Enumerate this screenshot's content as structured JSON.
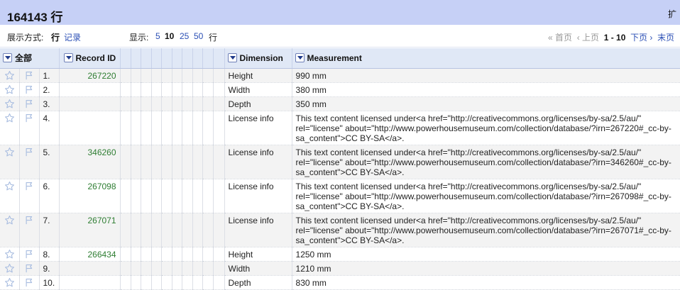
{
  "header": {
    "row_count": "164143 行",
    "right_label": "扩"
  },
  "view": {
    "label": "展示方式:",
    "rows_mode": "行",
    "records_mode": "记录",
    "show_label": "显示:",
    "page_sizes": [
      "5",
      "10",
      "25",
      "50"
    ],
    "page_size_selected": "10",
    "rows_suffix": "行"
  },
  "pager": {
    "first": "« 首页",
    "prev": "‹ 上页",
    "range": "1 - 10",
    "next": "下页 ›",
    "last": "末页"
  },
  "columns": {
    "all": "全部",
    "record_id": "Record ID",
    "dimension": "Dimension",
    "measurement": "Measurement"
  },
  "rows": [
    {
      "index": "1.",
      "record_id": "267220",
      "dimension": "Height",
      "measurement": "990 mm"
    },
    {
      "index": "2.",
      "record_id": "",
      "dimension": "Width",
      "measurement": "380 mm"
    },
    {
      "index": "3.",
      "record_id": "",
      "dimension": "Depth",
      "measurement": "350 mm"
    },
    {
      "index": "4.",
      "record_id": "",
      "dimension": "License info",
      "measurement": "This text content licensed under<a href=\"http://creativecommons.org/licenses/by-sa/2.5/au/\" rel=\"license\" about=\"http://www.powerhousemuseum.com/collection/database/?irn=267220#_cc-by-sa_content\">CC BY-SA</a>."
    },
    {
      "index": "5.",
      "record_id": "346260",
      "dimension": "License info",
      "measurement": "This text content licensed under<a href=\"http://creativecommons.org/licenses/by-sa/2.5/au/\" rel=\"license\" about=\"http://www.powerhousemuseum.com/collection/database/?irn=346260#_cc-by-sa_content\">CC BY-SA</a>."
    },
    {
      "index": "6.",
      "record_id": "267098",
      "dimension": "License info",
      "measurement": "This text content licensed under<a href=\"http://creativecommons.org/licenses/by-sa/2.5/au/\" rel=\"license\" about=\"http://www.powerhousemuseum.com/collection/database/?irn=267098#_cc-by-sa_content\">CC BY-SA</a>."
    },
    {
      "index": "7.",
      "record_id": "267071",
      "dimension": "License info",
      "measurement": "This text content licensed under<a href=\"http://creativecommons.org/licenses/by-sa/2.5/au/\" rel=\"license\" about=\"http://www.powerhousemuseum.com/collection/database/?irn=267071#_cc-by-sa_content\">CC BY-SA</a>."
    },
    {
      "index": "8.",
      "record_id": "266434",
      "dimension": "Height",
      "measurement": "1250 mm"
    },
    {
      "index": "9.",
      "record_id": "",
      "dimension": "Width",
      "measurement": "1210 mm"
    },
    {
      "index": "10.",
      "record_id": "",
      "dimension": "Depth",
      "measurement": "830 mm"
    }
  ],
  "colors": {
    "header_bg": "#c6d0f6",
    "column_header_bg": "#e0e8f6",
    "link": "#2b4fb5",
    "record_id": "#2e7d32",
    "star_icon": "#a9bde0"
  },
  "icons": {
    "star": "star-icon",
    "flag": "flag-icon",
    "dropdown": "dropdown-arrow-icon"
  }
}
